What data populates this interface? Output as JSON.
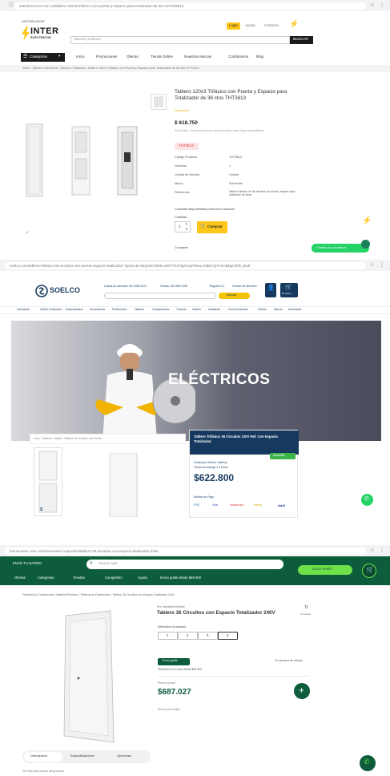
{
  "s1": {
    "url": "interelectricos.com.co/tablero-120x3-trifasico-con-puerta-y-espacio-para-totalizador-de-36-ctos-tht3613",
    "logo_top": "DISTRIBUIDOR",
    "logo": "INTER",
    "logo_sub": "ELÉCTRICOS",
    "top_links": [
      "Login",
      "Ayuda",
      "Contacto"
    ],
    "search_placeholder": "Buscar producto",
    "search_button": "BUSCAR",
    "menu_categories": "Categorías",
    "nav": [
      "Inicio",
      "Promociones",
      "Ofertas",
      "Tienda Online",
      "Nuestras Marcas",
      "Contáctenos",
      "Blog"
    ],
    "breadcrumb": "Inicio / Tableros Eléctricos / Tableros Trifásicos / Tablero 120x3 Trifásico con Puerta y Espacio para Totalizador de 36 ctos THT3613",
    "title": "Tablero 120x3 Trifásico con Puerta y Espacio para Totalizador de 36 ctos THT3613",
    "brand_badge": "Schneider",
    "price": "$ 618.750",
    "price_note": "IVA incluido. Los precios pueden variar sin previo aviso según disponibilidad",
    "tag": "THT3613",
    "specs": [
      [
        "Código Producto",
        "THT3613"
      ],
      [
        "Garantía",
        "1"
      ],
      [
        "Unidad de Medida",
        "Unidad"
      ],
      [
        "Marca",
        "Schneider"
      ],
      [
        "Referencia",
        "Tablero trifásico de 36 circuitos con puerta, espacio para totalizador de línea"
      ]
    ],
    "shipping": "Consultar disponibilidad para envío nacional",
    "qty_label": "Cantidad",
    "qty": "1",
    "add_button": "Comprar",
    "share": "Compartir",
    "whatsapp": "Chatea con un asesor"
  },
  "s2": {
    "url": "soelco.com/tablero-trifasico-36-circuitos-con-puerta-espacio-totalizador-?gclid=EAIaIQobChMIlLo4sfTYXX7g2n1qFRbuL1ABEAQYASABEgI1hfD_BwE",
    "logo": "SOELCO",
    "contact_info": [
      "Lineas de atención: 601 555 0123",
      "Ventas: 310 555 0199",
      "Bogotá D.C.",
      "Horario de atención"
    ],
    "search_label": "Buscar",
    "cart_label": "Mi carrito",
    "nav": [
      "Iluminación",
      "Cables & Alambres",
      "Automatización",
      "Herramientas",
      "Protecciones",
      "Tableros",
      "Canalizaciones",
      "Tuberías",
      "Solares",
      "Instalación",
      "Control Industrial",
      "Ofertas",
      "Marcas",
      "Novedades"
    ],
    "hero_text": "ELÉCTRICOS",
    "breadcrumb": "Inicio / Tableros / Tablero Trifásico 36 Circuitos con Puerta",
    "title": "Tablero Trifásico 36 Circuitos 120V Ref. Con Espacio Totalizador",
    "stock": "Disponible",
    "seller_line1": "Vendido por Soelco: Tableros",
    "seller_line2": "Tiempo de entrega: 3 a 5 días",
    "price": "$622.800",
    "pay_label": "Medios de Pago",
    "pay_methods": [
      "PSE",
      "Visa",
      "Mastercard",
      "Efecty",
      "Addi"
    ]
  },
  "s3": {
    "url": "homecenter.com.co/homecenter-co/product/tablero-36-circuitos-con-espacio-totalizador-240v",
    "location": "ENVÍA TU BARRIO",
    "search_placeholder": "Buscar aquí",
    "nav": [
      "Ofertas",
      "Categorías",
      "Tiendas",
      "Compártelo",
      "Ayuda",
      "Envío gratis desde $99.900"
    ],
    "login_button": "Iniciar sesión",
    "breadcrumb": "Ferretería y Construcción / Material Eléctrico / Tableros de Distribución / Tablero 36 Circuitos con Espacio Totalizador 240V",
    "brand": "Por Schneider Electric",
    "title": "Tablero 36 Circuitos con Espacio Totalizador 240V",
    "compare": "Comparar",
    "options_label": "Seleccione la cantidad",
    "options": [
      "1",
      "2",
      "3",
      "4"
    ],
    "badge": "Envío gratis",
    "info1": "Recíbelo en tu casa desde $99.900",
    "info_link": "Ver opciones de entrega",
    "price_label": "Precio normal",
    "price": "$687.027",
    "price_sub": "Precio por unidad",
    "tabs": [
      "Descripción",
      "Especificaciones",
      "Opiniones"
    ],
    "bottom_text": "Ver más información del producto"
  },
  "colors": {
    "inter_yellow": "#ffc61a",
    "inter_dark": "#1b1b1b",
    "soelco_blue": "#163a5f",
    "soelco_yellow": "#f2c100",
    "hc_green": "#0d5c3b",
    "hc_lime": "#6ee04a"
  }
}
